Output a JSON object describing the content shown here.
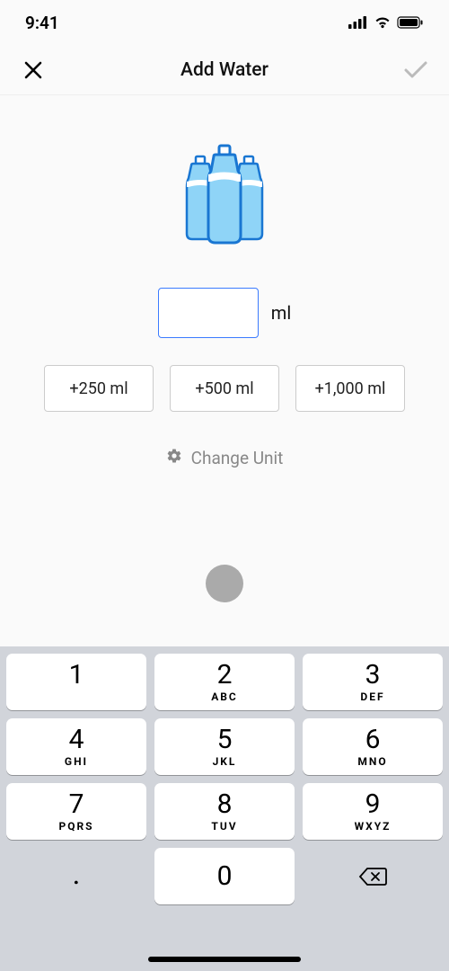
{
  "status": {
    "time": "9:41"
  },
  "nav": {
    "title": "Add Water"
  },
  "input": {
    "value": "",
    "unit": "ml",
    "placeholder": ""
  },
  "quick": [
    {
      "label": "+250 ml"
    },
    {
      "label": "+500 ml"
    },
    {
      "label": "+1,000 ml"
    }
  ],
  "change_unit": "Change Unit",
  "keypad": {
    "rows": [
      [
        {
          "digit": "1",
          "letters": ""
        },
        {
          "digit": "2",
          "letters": "ABC"
        },
        {
          "digit": "3",
          "letters": "DEF"
        }
      ],
      [
        {
          "digit": "4",
          "letters": "GHI"
        },
        {
          "digit": "5",
          "letters": "JKL"
        },
        {
          "digit": "6",
          "letters": "MNO"
        }
      ],
      [
        {
          "digit": "7",
          "letters": "PQRS"
        },
        {
          "digit": "8",
          "letters": "TUV"
        },
        {
          "digit": "9",
          "letters": "WXYZ"
        }
      ],
      [
        {
          "digit": ".",
          "letters": "",
          "style": "blank"
        },
        {
          "digit": "0",
          "letters": ""
        },
        {
          "digit": "",
          "letters": "",
          "style": "backspace"
        }
      ]
    ]
  }
}
